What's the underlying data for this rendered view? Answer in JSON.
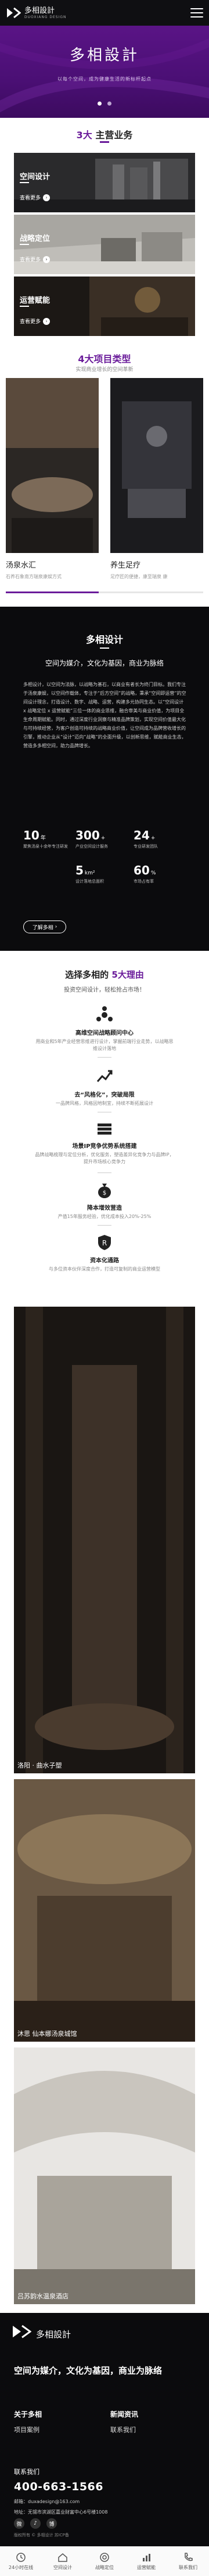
{
  "header": {
    "brand": "多相設計",
    "brand_sub": "DUOXIANG DESIGN"
  },
  "hero": {
    "title": "多相設計",
    "subtitle": "以每个空间，成为健康生活的新标杆起点"
  },
  "business": {
    "title_num": "3大",
    "title_rest": " 主营业务",
    "items": [
      {
        "name": "空间设计",
        "more": "查看更多"
      },
      {
        "name": "战略定位",
        "more": "查看更多"
      },
      {
        "name": "运营赋能",
        "more": "查看更多"
      }
    ]
  },
  "projects": {
    "title": "4大项目类型",
    "subtitle": "实现商业增长的空间革新",
    "items": [
      {
        "name": "汤泉水汇",
        "desc": "石养石象南方瑞泉康娱方式"
      },
      {
        "name": "养生足疗",
        "desc": "足疗匠的便捷，康至瑞泉 康"
      }
    ]
  },
  "about": {
    "title": "多相设计",
    "slogan": "空间为媒介，文化为基因，商业为脉络",
    "paragraph": "多相设计，以空间为法脉，以战略为基石，以商业有者长为终门目标。我们专注于汤泉康娱，以空间作载体，专注于“后方空间”的战略，秉承“空间即运营”的空间设计理念，打造设计、数字、战略、运营，构建多元协同生态。以“空间设计 x 战略定位 x 运营赋能”三位一体的商业思维，融合审美与商业价值，为项目全生命周期赋能。同时，通过深度行业洞察与精准品牌策划，实现空间价值最大化与可持续经营，为客户创造可持续的战略商业价值，让空间成为品牌营收增长的引擎，推动企业从“设计”迈向“战略”的全面升级，以创新思维，赋能商业生态，营造多多相空间，助力品牌增长。",
    "stats": [
      {
        "num": "10",
        "unit": "年",
        "label": "聚焦汤泉十余年专注研发"
      },
      {
        "num": "300",
        "unit": "+",
        "label": "产业空间设计服务"
      },
      {
        "num": "24",
        "unit": "+",
        "label": "专业研发团队"
      },
      {
        "num": "5",
        "unit": "km²",
        "label": "设计落地总面积"
      },
      {
        "num": "60",
        "unit": "%",
        "label": "市场占有率"
      }
    ],
    "button": "了解多相"
  },
  "reasons": {
    "title_pre": "选择多相的 ",
    "title_accent": "5大理由",
    "subtitle": "投资空间设计，轻松抢占市场！",
    "items": [
      {
        "title": "高维空间战略顾问中心",
        "desc": "用商业和5年产业经营思维进行设计，掌握前端行业走势，以战略思维设计落地"
      },
      {
        "title": "去“风格化”，突破局限",
        "desc": "一品牌风格，风格因地制宜，持续不断拓展设计"
      },
      {
        "title": "场景IP竞争优势系统搭建",
        "desc": "品牌战略梳理与定位分析，优化服务，塑造差异化竞争力与品牌IP，提升市场核心竞争力"
      },
      {
        "title": "降本增效营造",
        "desc": "产值15年服务经验，优化成本投入20%-25%"
      },
      {
        "title": "资本化通路",
        "desc": "与多位资本伙伴深度合作，打造可复制的商业运营模型"
      }
    ]
  },
  "cases": [
    {
      "name": "洛阳 · 曲水子塑"
    },
    {
      "name": "沐思 仙本娜汤泉城馆"
    },
    {
      "name": "吕苏韵水温泉酒店"
    }
  ],
  "footer": {
    "brand": "多相設計",
    "slogan": "空间为媒介，文化为基因，商业为脉络",
    "nav": [
      "关于多相",
      "新闻资讯"
    ],
    "nav2": [
      "项目案例",
      "联系我们"
    ],
    "contact_title": "联系我们",
    "phone": "400-663-1566",
    "email": "邮箱：duxadesign@163.com",
    "address": "地址：无锡市滨湖区嘉业财富中心6号楼1008",
    "copyright": "版权所有 © 多相设计 苏ICP备"
  },
  "tabbar": [
    {
      "label": "24小时在线"
    },
    {
      "label": "空间设计"
    },
    {
      "label": "战略定位"
    },
    {
      "label": "运营赋能"
    },
    {
      "label": "联系我们"
    }
  ]
}
